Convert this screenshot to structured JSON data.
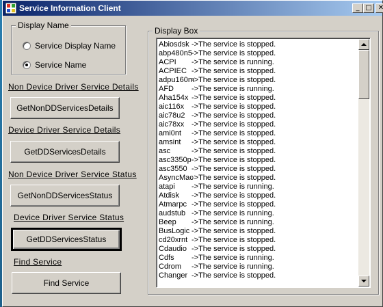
{
  "window": {
    "title": "Service Information Client",
    "minimize_glyph": "_",
    "maximize_glyph": "□",
    "close_glyph": "✕"
  },
  "display_name": {
    "group_title": "Display Name",
    "option_display": "Service Display Name",
    "option_name": "Service Name",
    "selected": "Service Name"
  },
  "sections": {
    "non_dd_details_label": "Non Device Driver Service Details",
    "non_dd_details_button": "GetNonDDServicesDetails",
    "dd_details_label": "Device Driver Service Details",
    "dd_details_button": "GetDDServicesDetails",
    "non_dd_status_label": "Non Device Driver  Service Status",
    "non_dd_status_button": "GetNonDDServicesStatus",
    "dd_status_label": "Device Driver Service Status",
    "dd_status_button": "GetDDServicesStatus",
    "find_label": "Find Service",
    "find_button": "Find Service"
  },
  "display_box": {
    "group_title": "Display Box",
    "rows": [
      {
        "name": "Abiosdsk",
        "status": "->The service is stopped."
      },
      {
        "name": "abp480n5",
        "status": "->The service is stopped."
      },
      {
        "name": "ACPI",
        "status": "->The service is running."
      },
      {
        "name": "ACPIEC",
        "status": "->The service is stopped."
      },
      {
        "name": "adpu160m",
        "status": "->The service is stopped."
      },
      {
        "name": "AFD",
        "status": "->The service is running."
      },
      {
        "name": "Aha154x",
        "status": "->The service is stopped."
      },
      {
        "name": "aic116x",
        "status": "->The service is stopped."
      },
      {
        "name": "aic78u2",
        "status": "->The service is stopped."
      },
      {
        "name": "aic78xx",
        "status": "->The service is stopped."
      },
      {
        "name": "ami0nt",
        "status": "->The service is stopped."
      },
      {
        "name": "amsint",
        "status": "->The service is stopped."
      },
      {
        "name": "asc",
        "status": "->The service is stopped."
      },
      {
        "name": "asc3350p",
        "status": "->The service is stopped."
      },
      {
        "name": "asc3550",
        "status": "->The service is stopped."
      },
      {
        "name": "AsyncMac",
        "status": "->The service is stopped."
      },
      {
        "name": "atapi",
        "status": "->The service is running."
      },
      {
        "name": "Atdisk",
        "status": "->The service is stopped."
      },
      {
        "name": "Atmarpc",
        "status": "->The service is stopped."
      },
      {
        "name": "audstub",
        "status": "->The service is running."
      },
      {
        "name": "Beep",
        "status": "->The service is running."
      },
      {
        "name": "BusLogic",
        "status": "->The service is stopped."
      },
      {
        "name": "cd20xrnt",
        "status": "->The service is stopped."
      },
      {
        "name": "Cdaudio",
        "status": "->The service is stopped."
      },
      {
        "name": "Cdfs",
        "status": "->The service is running."
      },
      {
        "name": "Cdrom",
        "status": "->The service is running."
      },
      {
        "name": "Changer",
        "status": "->The service is stopped."
      }
    ],
    "scroll_up_glyph": "▲",
    "scroll_down_glyph": "▼"
  }
}
